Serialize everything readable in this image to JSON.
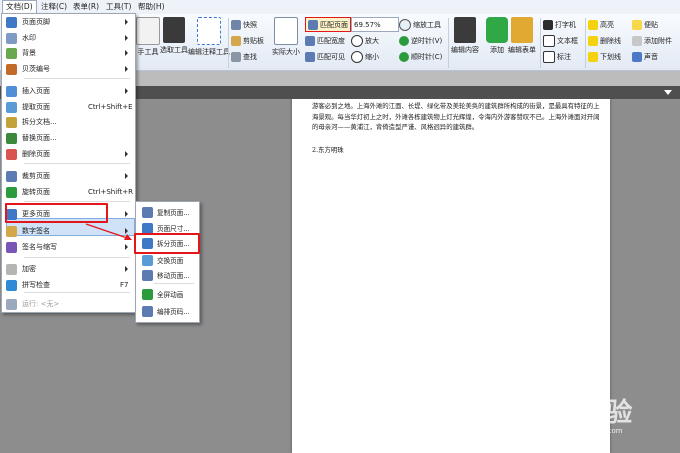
{
  "menubar": [
    {
      "label": "文档(D)",
      "active": true
    },
    {
      "label": "注释(C)"
    },
    {
      "label": "表单(R)"
    },
    {
      "label": "工具(T)"
    },
    {
      "label": "帮助(H)"
    }
  ],
  "ribbon": {
    "tools": {
      "hand": "手工具",
      "select": "选取工具",
      "edit_annot": "编辑注释工具"
    },
    "snapshot": "快照",
    "clipboard": "剪贴板",
    "find": "查找",
    "actual_size": "实际大小",
    "fit_page": "匹配页面",
    "fit_width": "匹配宽度",
    "fit_visible": "匹配可见",
    "zoom_value": "69.57%",
    "zoom_in": "放大",
    "zoom_out": "缩小",
    "zoom_tool": "缩放工具",
    "rotate_ccw": "逆时针(V)",
    "rotate_cw": "顺时针(C)",
    "edit_content": "编辑内容",
    "add": "添加",
    "edit_form": "编辑表单",
    "typewriter": "打字机",
    "textbox": "文本框",
    "callout": "标注",
    "highlight": "高亮",
    "strikeout": "删除线",
    "underline": "下划线",
    "note": "便贴",
    "attach": "添加附件",
    "sound": "声音"
  },
  "document": {
    "paragraph": "游客必到之地。上海外滩的江面、长堤、绿化带及美轮美奂的建筑群所构成的街景，是最具有特征的上海景观。每当华灯初上之时，外滩各栋建筑物上灯光辉煌，令海内外游客赞叹不已。上海外滩面对开阔的母亲河——黄浦江，背倚造型严谨、风格迥异的建筑群。",
    "section": "2.东方明珠"
  },
  "doc_menu": {
    "items": [
      {
        "label": "页面页脚",
        "icon": "header-footer-icon",
        "arrow": true
      },
      {
        "label": "水印",
        "icon": "watermark-icon",
        "arrow": true
      },
      {
        "label": "背景",
        "icon": "background-icon",
        "arrow": true
      },
      {
        "label": "贝茨编号",
        "icon": "bates-icon",
        "arrow": true
      },
      {
        "label": "插入页面",
        "icon": "insert-page-icon",
        "arrow": true
      },
      {
        "label": "提取页面",
        "icon": "extract-page-icon",
        "shortcut": "Ctrl+Shift+E"
      },
      {
        "label": "拆分文档...",
        "icon": "split-doc-icon"
      },
      {
        "label": "替换页面...",
        "icon": "replace-page-icon"
      },
      {
        "label": "删除页面",
        "icon": "delete-page-icon",
        "arrow": true
      },
      {
        "label": "裁剪页面",
        "icon": "crop-page-icon",
        "arrow": true
      },
      {
        "label": "旋转页面",
        "icon": "rotate-page-icon",
        "shortcut": "Ctrl+Shift+R"
      },
      {
        "label": "更多页面",
        "icon": "more-pages-icon",
        "arrow": true
      },
      {
        "label": "数字签名",
        "icon": "digital-sign-icon",
        "arrow": true
      },
      {
        "label": "签名与缩写",
        "icon": "sign-initial-icon",
        "arrow": true
      },
      {
        "label": "加密",
        "icon": "encrypt-icon",
        "arrow": true
      },
      {
        "label": "拼写检查",
        "icon": "spell-check-icon",
        "shortcut": "F7"
      },
      {
        "label": "运行: <无>",
        "icon": "run-icon",
        "disabled": true
      }
    ]
  },
  "sub_menu": {
    "items": [
      {
        "label": "复制页面...",
        "icon": "duplicate-page-icon"
      },
      {
        "label": "页面尺寸...",
        "icon": "page-size-icon"
      },
      {
        "label": "拆分页面...",
        "icon": "split-page-icon"
      },
      {
        "label": "交换页面",
        "icon": "swap-page-icon"
      },
      {
        "label": "移动页面...",
        "icon": "move-page-icon"
      },
      {
        "label": "全屏动画",
        "icon": "fullscreen-anim-icon"
      },
      {
        "label": "编排页码...",
        "icon": "page-number-icon"
      }
    ]
  },
  "watermark": {
    "brand": "Bai 经验",
    "url": "jingyan.baidu.com"
  },
  "colors": {
    "highlight": "#cfe2f8",
    "annotation_red": "#e3161b",
    "menubar": "#eef3fa"
  }
}
